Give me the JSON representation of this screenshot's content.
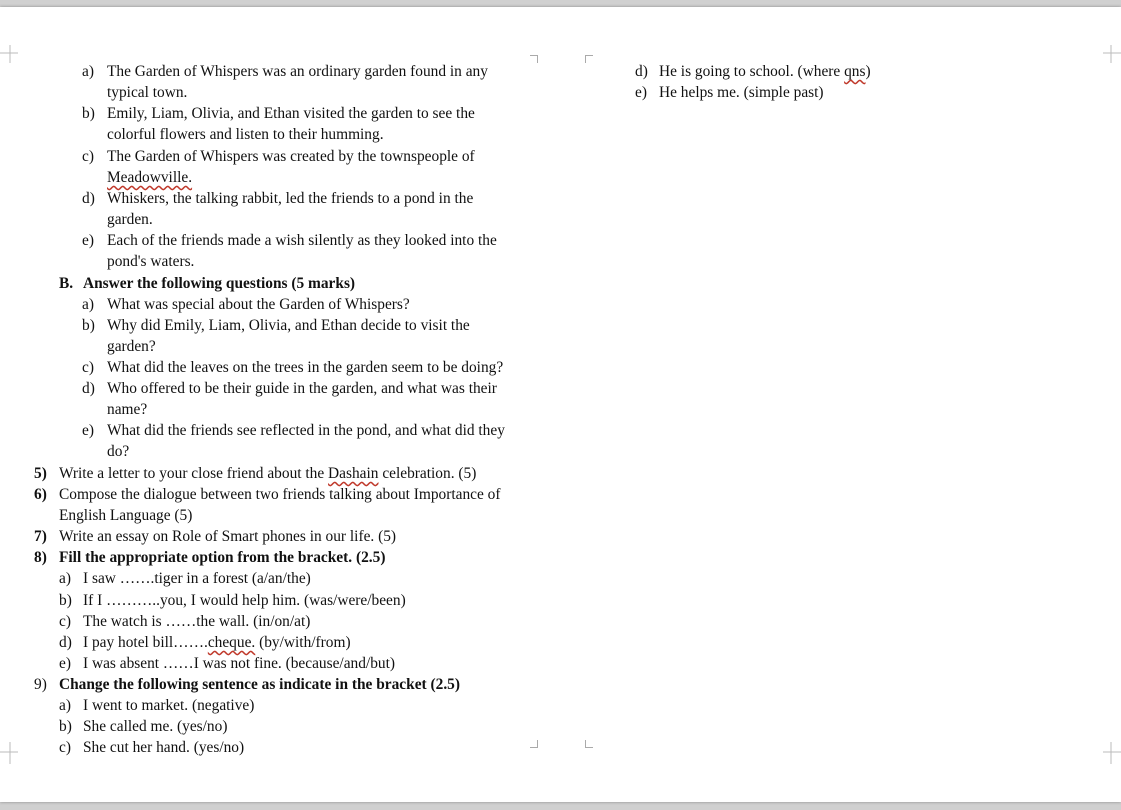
{
  "left_column": {
    "part_a_items": [
      {
        "label": "a)",
        "lines": [
          "The Garden of Whispers was an ordinary garden found in any",
          "typical town."
        ]
      },
      {
        "label": "b)",
        "lines": [
          "Emily, Liam, Olivia, and Ethan visited the garden to see the",
          "colorful flowers and listen to their humming."
        ]
      },
      {
        "label": "c)",
        "lines": [
          "The Garden of Whispers was created by the townspeople of",
          "Meadowville."
        ]
      },
      {
        "label": "d)",
        "lines": [
          "Whiskers, the talking rabbit, led the friends to a pond in the",
          "garden."
        ]
      },
      {
        "label": "e)",
        "lines": [
          "Each of the friends made a wish silently as they looked into the",
          "pond's waters."
        ]
      }
    ],
    "section_b": {
      "label": "B.",
      "heading": "Answer the following questions (5 marks)",
      "items": [
        {
          "label": "a)",
          "lines": [
            "What was special about the Garden of Whispers?"
          ]
        },
        {
          "label": "b)",
          "lines": [
            "Why did Emily, Liam, Olivia, and Ethan decide to visit the",
            "garden?"
          ]
        },
        {
          "label": "c)",
          "lines": [
            "What did the leaves on the trees in the garden seem to be doing?"
          ]
        },
        {
          "label": "d)",
          "lines": [
            "Who offered to be their guide in the garden, and what was their",
            "name?"
          ]
        },
        {
          "label": "e)",
          "lines": [
            "What did the friends see reflected in the pond, and what did they",
            "do?"
          ]
        }
      ]
    },
    "q5": {
      "num": "5)",
      "pre": "Write a letter to your close friend about the ",
      "sq": "Dashain",
      "post": " celebration. (5)"
    },
    "q6": {
      "num": "6)",
      "lines": [
        "Compose the dialogue between two friends talking about Importance of",
        "English Language (5)"
      ]
    },
    "q7": {
      "num": "7)",
      "text": "Write an essay on Role of Smart phones in our life. (5)"
    },
    "q8": {
      "num": "8)",
      "heading": "Fill the appropriate option from the bracket. (2.5)",
      "items": [
        {
          "label": "a)",
          "text": "I saw …….tiger in a forest (a/an/the)"
        },
        {
          "label": "b)",
          "text": "If I ………..you, I would help him. (was/were/been)"
        },
        {
          "label": "c)",
          "text": "The watch is ……the wall. (in/on/at)"
        },
        {
          "label": "d)",
          "pre": "I pay hotel bill…….",
          "sq": "cheque.",
          "post": " (by/with/from)"
        },
        {
          "label": "e)",
          "text": "I was absent ……I was not fine. (because/and/but)"
        }
      ]
    },
    "q9": {
      "num": "9)",
      "heading": "Change the following sentence as indicate in the bracket (2.5)",
      "items": [
        {
          "label": "a)",
          "text": "I went to market. (negative)"
        },
        {
          "label": "b)",
          "text": "She called me. (yes/no)"
        },
        {
          "label": "c)",
          "text": "She cut her hand. (yes/no)"
        }
      ]
    }
  },
  "right_column": {
    "items": [
      {
        "label": "d)",
        "pre": "He is going to school. (where ",
        "sq": "qns",
        "post": ")"
      },
      {
        "label": "e)",
        "text": "He helps me. (simple past)"
      }
    ]
  }
}
